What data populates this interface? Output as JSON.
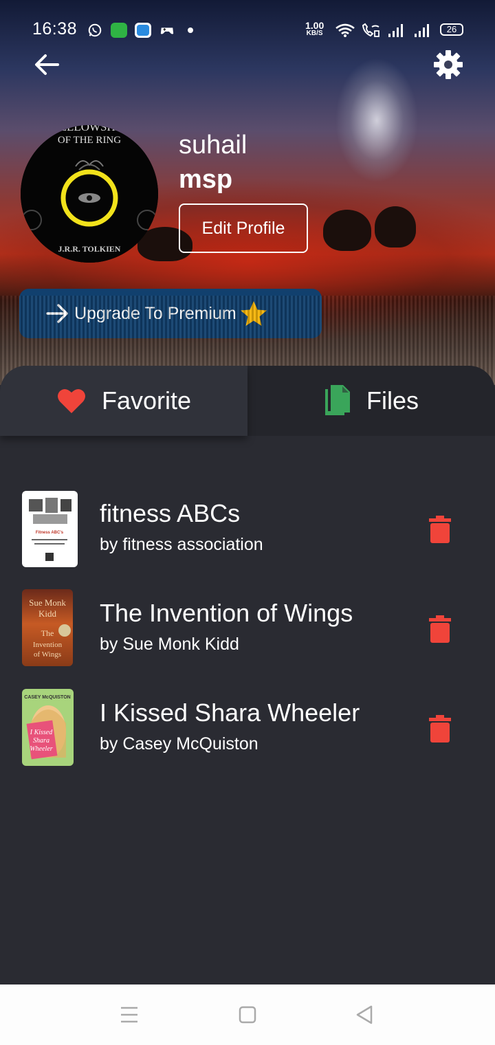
{
  "status_bar": {
    "time": "16:38",
    "net_speed_value": "1.00",
    "net_speed_unit": "KB/S",
    "battery": "26",
    "icons": [
      "whatsapp-icon",
      "app-green-icon",
      "app-blue-icon",
      "gamepad-icon",
      "wifi-icon",
      "wifi-calling-icon",
      "signal-icon",
      "signal-icon"
    ]
  },
  "header": {
    "back_icon": "arrow-left-icon",
    "settings_icon": "gear-icon"
  },
  "profile": {
    "avatar_text_top": "FELLOWSHIP",
    "avatar_text_mid": "OF THE RING",
    "avatar_text_bottom": "J.R.R. TOLKIEN",
    "first_name": "suhail",
    "last_name": "msp",
    "edit_label": "Edit Profile",
    "premium_label": "Upgrade To Premium"
  },
  "tabs": [
    {
      "label": "Favorite",
      "icon": "heart-icon",
      "color": "#f0443a"
    },
    {
      "label": "Files",
      "icon": "file-copy-icon",
      "color": "#3aa55a"
    }
  ],
  "books": [
    {
      "title": "fitness ABCs",
      "author": "by fitness association",
      "cover_label": "Fitness ABC's"
    },
    {
      "title": " The Invention of Wings",
      "author": "by Sue Monk Kidd",
      "cover_label": "Sue Monk Kidd The Invention of Wings"
    },
    {
      "title": "I Kissed Shara Wheeler",
      "author": "by  Casey McQuiston",
      "cover_label": "CASEY McQUISTON I Kissed Shara Wheeler"
    }
  ],
  "colors": {
    "background": "#2a2b32",
    "premium_button": "#11406e",
    "trash": "#f0443a",
    "star": "#f5b50a"
  },
  "nav": [
    "menu-icon",
    "home-icon",
    "back-triangle-icon"
  ]
}
